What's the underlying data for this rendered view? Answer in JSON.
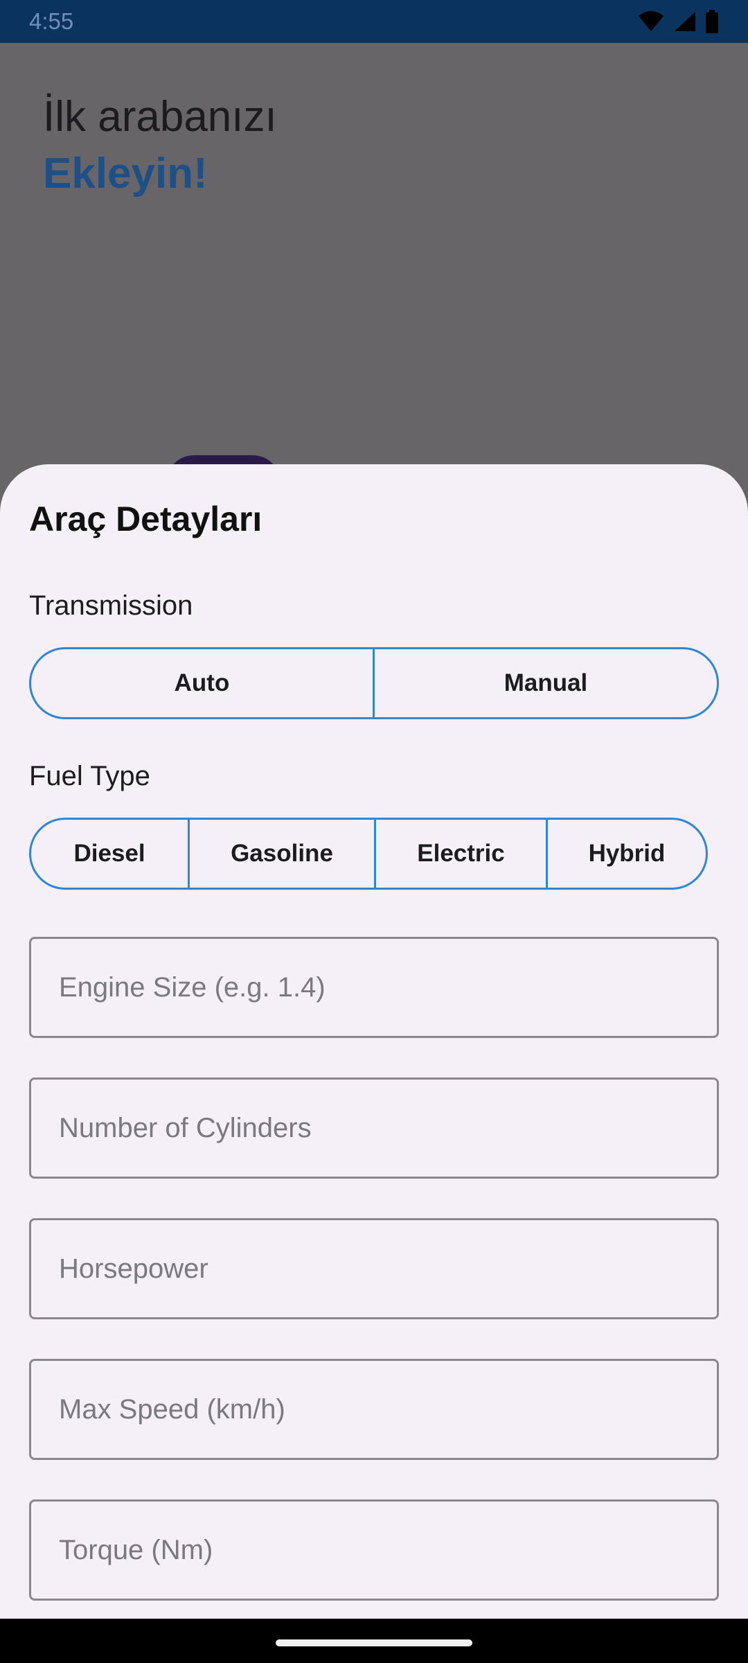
{
  "status_bar": {
    "time": "4:55",
    "icons": [
      "wifi-icon",
      "signal-icon",
      "battery-icon"
    ]
  },
  "background": {
    "headline_line1": "İlk arabanızı",
    "headline_line2": "Ekleyin!"
  },
  "sheet": {
    "title": "Araç Detayları",
    "transmission": {
      "label": "Transmission",
      "options": [
        "Auto",
        "Manual"
      ]
    },
    "fuel_type": {
      "label": "Fuel Type",
      "options": [
        "Diesel",
        "Gasoline",
        "Electric",
        "Hybrid"
      ]
    },
    "fields": {
      "engine_size": {
        "placeholder": "Engine Size (e.g. 1.4)",
        "value": ""
      },
      "cylinders": {
        "placeholder": "Number of Cylinders",
        "value": ""
      },
      "horsepower": {
        "placeholder": "Horsepower",
        "value": ""
      },
      "max_speed": {
        "placeholder": "Max Speed (km/h)",
        "value": ""
      },
      "torque": {
        "placeholder": "Torque (Nm)",
        "value": ""
      }
    }
  },
  "colors": {
    "status_bar": "#0b3360",
    "accent_outline": "#2f86d6",
    "headline_accent": "#1e4f86",
    "sheet_background": "#f5eff7",
    "scrim": "#676568"
  }
}
